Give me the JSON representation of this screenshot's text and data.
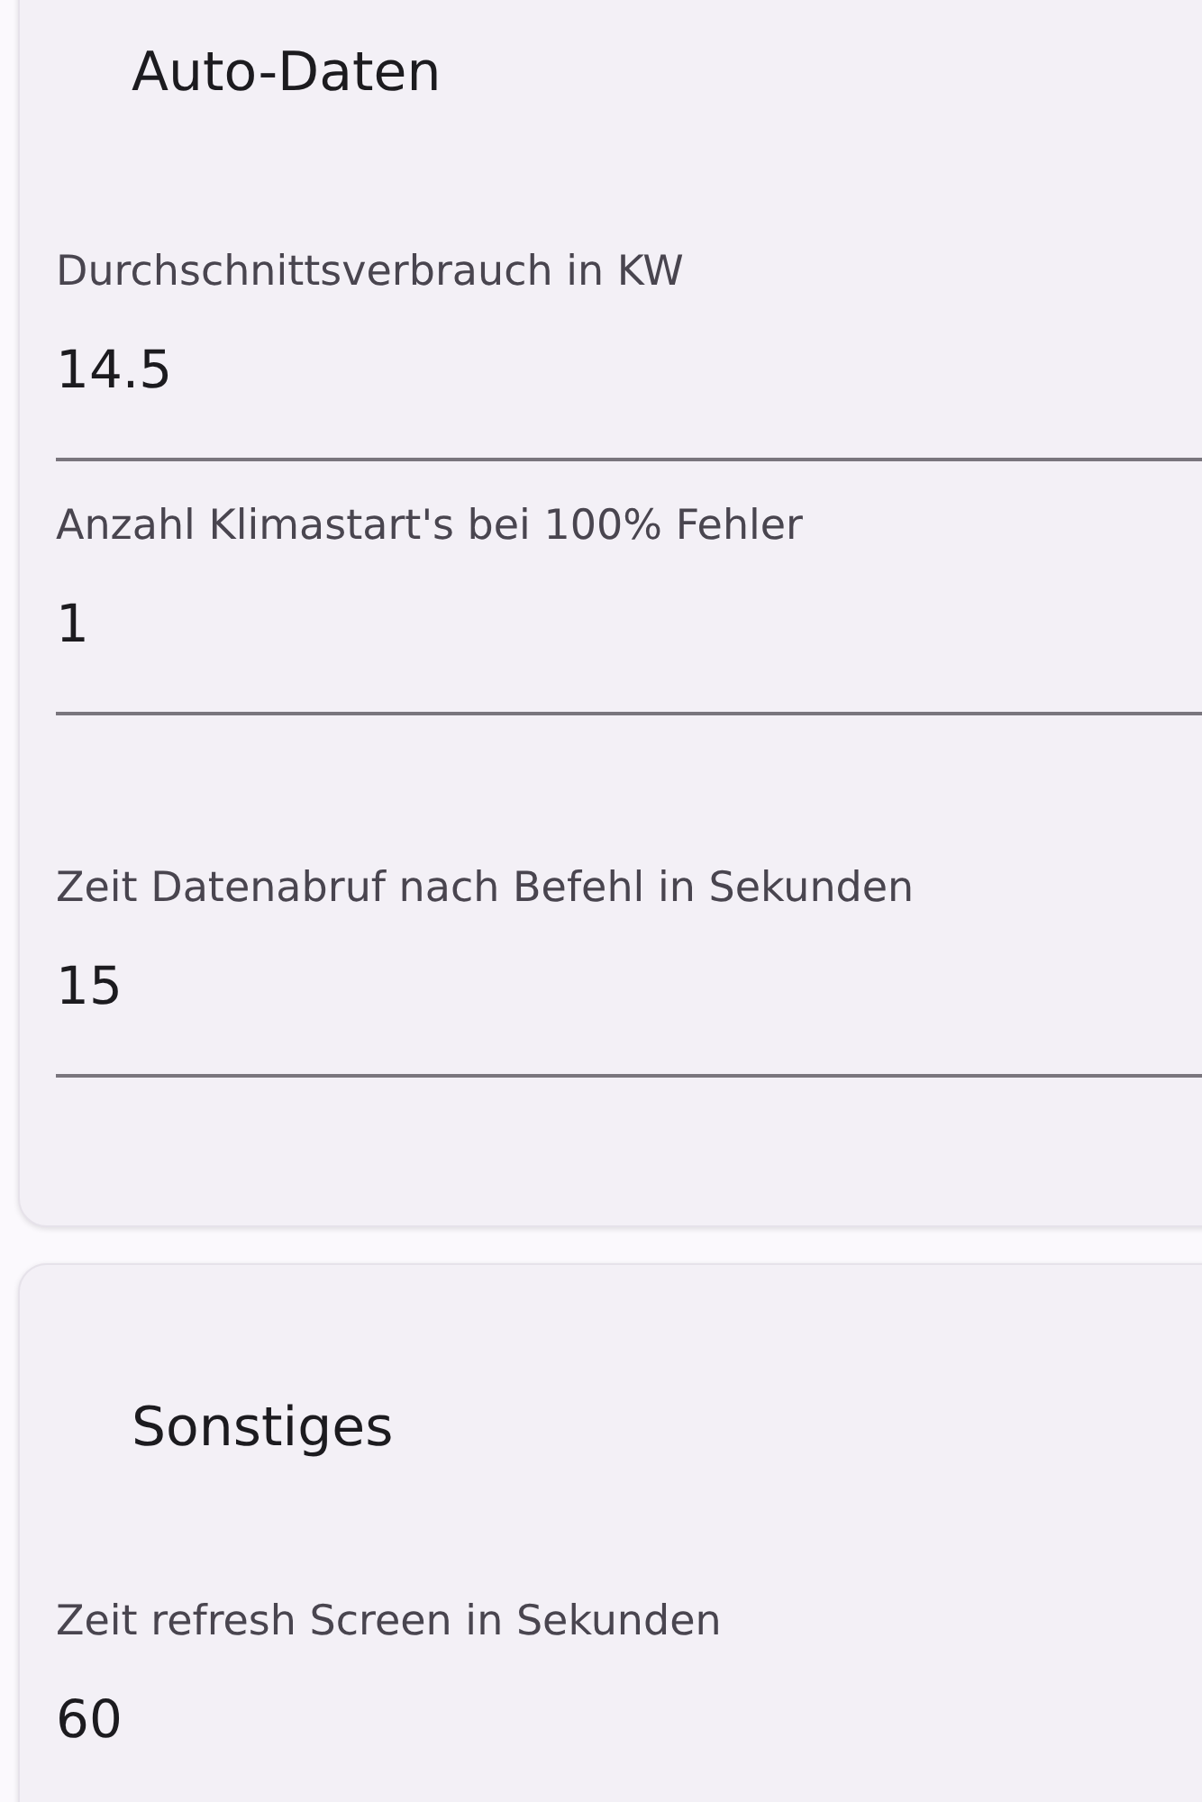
{
  "sections": [
    {
      "title": "Auto-Daten",
      "fields": [
        {
          "label": "Durchschnittsverbrauch in KW",
          "value": "14.5"
        },
        {
          "label": "Anzahl Klimastart's bei 100% Fehler",
          "value": "1"
        },
        {
          "label": "Zeit Datenabruf nach Befehl in Sekunden",
          "value": "15"
        }
      ]
    },
    {
      "title": "Sonstiges",
      "fields": [
        {
          "label": "Zeit refresh Screen in Sekunden",
          "value": "60"
        }
      ]
    }
  ]
}
